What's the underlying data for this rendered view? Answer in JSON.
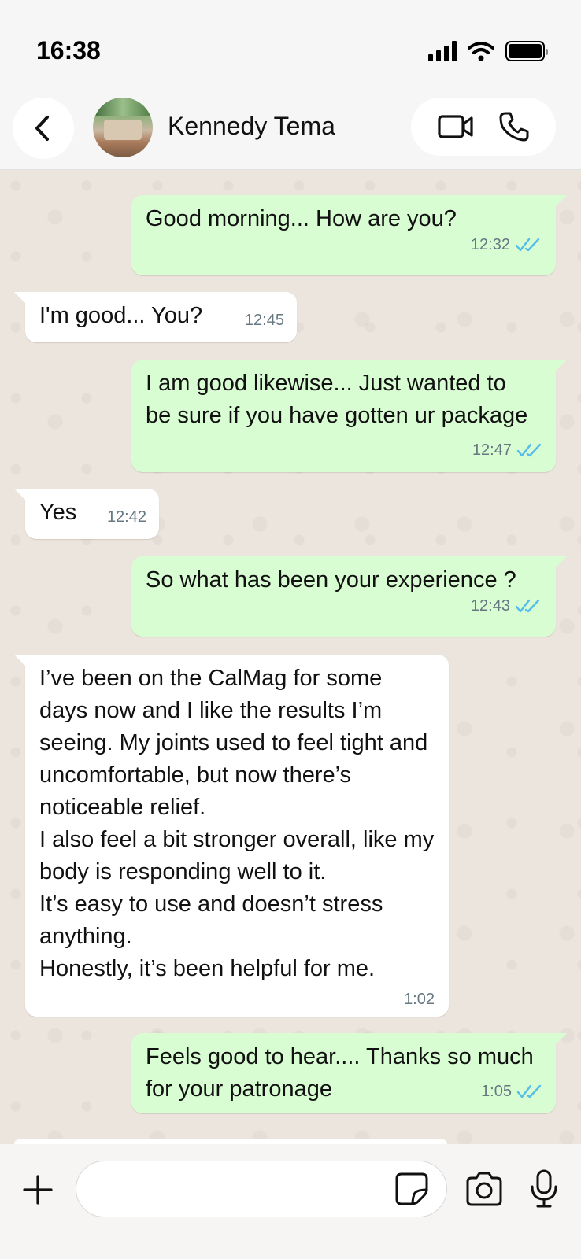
{
  "status_bar": {
    "time": "16:38"
  },
  "header": {
    "contact_name": "Kennedy Tema"
  },
  "colors": {
    "outgoing_bubble": "#d9fdd3",
    "incoming_bubble": "#ffffff",
    "read_ticks": "#53bdeb",
    "chat_background": "#ece5dd"
  },
  "messages": [
    {
      "direction": "out",
      "text": "Good morning... How are you?",
      "time": "12:32",
      "status": "read"
    },
    {
      "direction": "in",
      "text": "I'm good... You?",
      "time": "12:45"
    },
    {
      "direction": "out",
      "text": "I am good likewise... Just wanted to be sure if you have gotten ur package",
      "time": "12:47",
      "status": "read"
    },
    {
      "direction": "in",
      "text": "Yes",
      "time": "12:42"
    },
    {
      "direction": "out",
      "text": "So what has been your experience ?",
      "time": "12:43",
      "status": "read"
    },
    {
      "direction": "in",
      "text": "I’ve been on the CalMag for some days now and I like the results I’m seeing.  My joints used to feel tight and uncomfortable, but now there’s noticeable relief.\nI also feel a bit stronger overall, like my body is responding well to it.\nIt’s easy to use and doesn’t stress anything.\nHonestly, it’s been helpful for me.",
      "time": "1:02"
    },
    {
      "direction": "out",
      "text": "Feels good to hear.... Thanks so much for your patronage",
      "time": "1:05",
      "status": "read"
    }
  ],
  "composer": {
    "value": "",
    "placeholder": ""
  },
  "icons": {
    "back": "chevron-left-icon",
    "video": "video-camera-icon",
    "call": "phone-icon",
    "plus": "plus-icon",
    "sticker": "sticker-icon",
    "camera": "camera-icon",
    "mic": "microphone-icon"
  }
}
